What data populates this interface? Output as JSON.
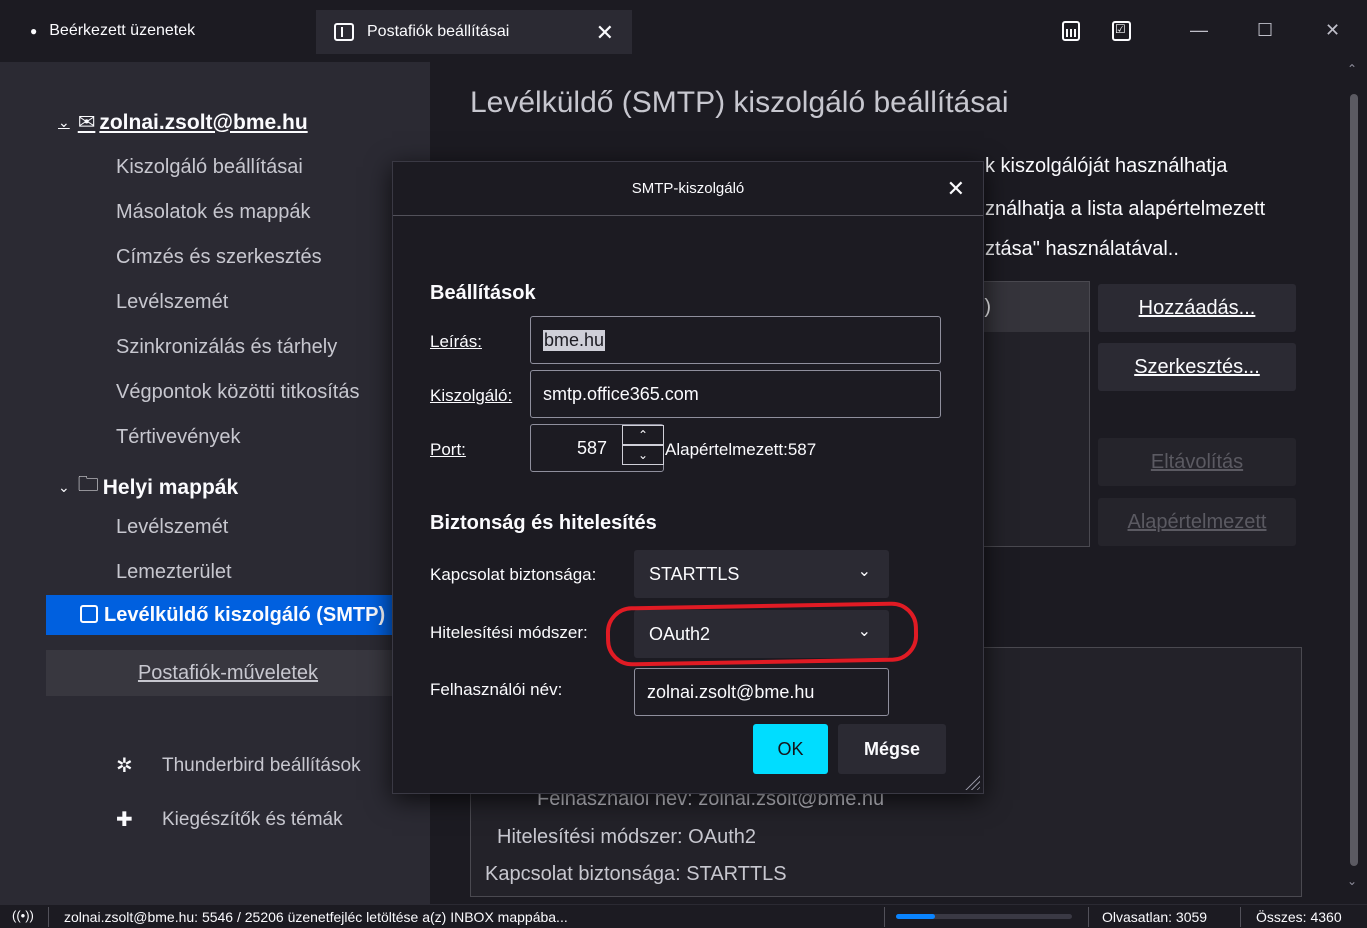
{
  "tabs": [
    {
      "label": "Beérkezett üzenetek"
    },
    {
      "label": "Postafiók beállításai",
      "close": "✕"
    }
  ],
  "window": {
    "minimize": "—",
    "maximize": "☐",
    "close": "✕"
  },
  "sidebar": {
    "account": "zolnai.zsolt@bme.hu",
    "account_items": [
      "Kiszolgáló beállításai",
      "Másolatok és mappák",
      "Címzés és szerkesztés",
      "Levélszemét",
      "Szinkronizálás és tárhely",
      "Végpontok közötti titkosítás",
      "Tértivevények"
    ],
    "local": "Helyi mappák",
    "local_items": [
      "Levélszemét",
      "Lemezterület"
    ],
    "selected": "Levélküldő kiszolgáló (SMTP)",
    "account_actions": "Postafiók-műveletek",
    "settings_link": "Thunderbird beállítások",
    "addons_link": "Kiegészítők és témák"
  },
  "main": {
    "title": "Levélküldő (SMTP) kiszolgáló beállításai",
    "desc_lines": [
      "k kiszolgálóját használhatja",
      "ználhatja a lista alapértelmezett",
      "ztása\" használatával.."
    ],
    "list_header": ")",
    "buttons": {
      "add": "Hozzáadás...",
      "edit": "Szerkesztés...",
      "remove": "Eltávolítás",
      "default": "Alapértelmezett"
    },
    "details": {
      "username_row": "Felhasználói név:  zolnai.zsolt@bme.hu",
      "auth_row": "Hitelesítési módszer:  OAuth2",
      "security_row": "Kapcsolat biztonsága:  STARTTLS"
    }
  },
  "dialog": {
    "title": "SMTP-kiszolgáló",
    "close": "✕",
    "settings_heading": "Beállítások",
    "description_label": "Leírás:",
    "description_value": "bme.hu",
    "server_label": "Kiszolgáló:",
    "server_value": "smtp.office365.com",
    "port_label": "Port:",
    "port_value": "587",
    "port_default": "Alapértelmezett:587",
    "security_heading": "Biztonság és hitelesítés",
    "conn_security_label": "Kapcsolat biztonsága:",
    "conn_security_value": "STARTTLS",
    "auth_method_label": "Hitelesítési módszer:",
    "auth_method_value": "OAuth2",
    "username_label": "Felhasználói név:",
    "username_value": "zolnai.zsolt@bme.hu",
    "ok": "OK",
    "cancel": "Mégse"
  },
  "statusbar": {
    "message": "zolnai.zsolt@bme.hu: 5546 / 25206 üzenetfejléc letöltése a(z) INBOX mappába...",
    "progress_fraction": 0.22,
    "unread": "Olvasatlan: 3059",
    "total": "Összes: 4360"
  },
  "colors": {
    "accent": "#0060df",
    "ok_button": "#00ddff",
    "highlight_ring": "#e01b24"
  }
}
